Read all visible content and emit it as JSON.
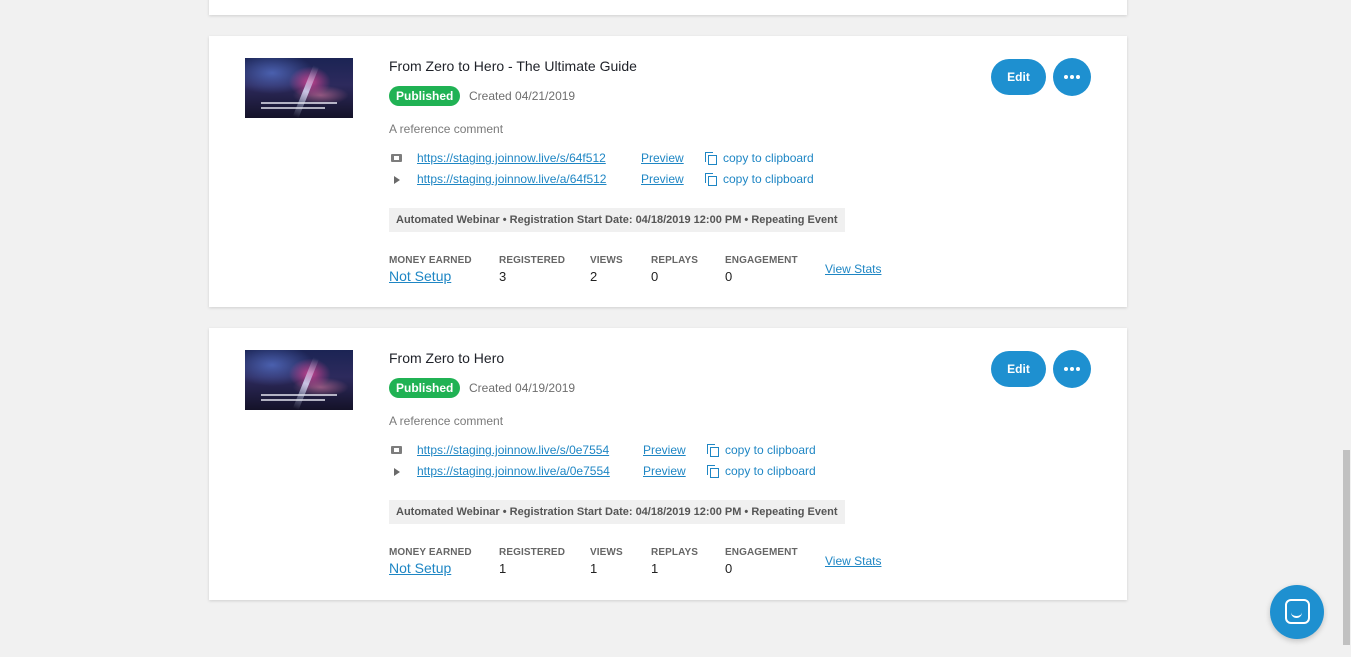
{
  "webinars": [
    {
      "title": "From Zero to Hero - The Ultimate Guide",
      "status": "Published",
      "created": "Created 04/21/2019",
      "comment": "A reference comment",
      "links": [
        {
          "url": "https://staging.joinnow.live/s/64f512",
          "preview": "Preview",
          "copy": "copy to clipboard"
        },
        {
          "url": "https://staging.joinnow.live/a/64f512",
          "preview": "Preview",
          "copy": "copy to clipboard"
        }
      ],
      "meta": "Automated Webinar • Registration Start Date: 04/18/2019 12:00 PM • Repeating Event",
      "stats": {
        "money_label": "MONEY EARNED",
        "money_value": "Not Setup",
        "registered_label": "REGISTERED",
        "registered_value": "3",
        "views_label": "VIEWS",
        "views_value": "2",
        "replays_label": "REPLAYS",
        "replays_value": "0",
        "engagement_label": "ENGAGEMENT",
        "engagement_value": "0"
      },
      "view_stats": "View Stats",
      "edit_label": "Edit"
    },
    {
      "title": "From Zero to Hero",
      "status": "Published",
      "created": "Created 04/19/2019",
      "comment": "A reference comment",
      "links": [
        {
          "url": "https://staging.joinnow.live/s/0e7554",
          "preview": "Preview",
          "copy": "copy to clipboard"
        },
        {
          "url": "https://staging.joinnow.live/a/0e7554",
          "preview": "Preview",
          "copy": "copy to clipboard"
        }
      ],
      "meta": "Automated Webinar • Registration Start Date: 04/18/2019 12:00 PM • Repeating Event",
      "stats": {
        "money_label": "MONEY EARNED",
        "money_value": "Not Setup",
        "registered_label": "REGISTERED",
        "registered_value": "1",
        "views_label": "VIEWS",
        "views_value": "1",
        "replays_label": "REPLAYS",
        "replays_value": "1",
        "engagement_label": "ENGAGEMENT",
        "engagement_value": "0"
      },
      "view_stats": "View Stats",
      "edit_label": "Edit"
    }
  ],
  "icons": {
    "registration_link": "ticket-icon",
    "attendee_link": "play-icon",
    "copy": "copy-icon",
    "more": "more-icon",
    "chat": "chat-icon"
  },
  "colors": {
    "accent": "#1e90d0",
    "link": "#1e86c4",
    "published_badge": "#20b254",
    "background": "#f1f1f1"
  }
}
